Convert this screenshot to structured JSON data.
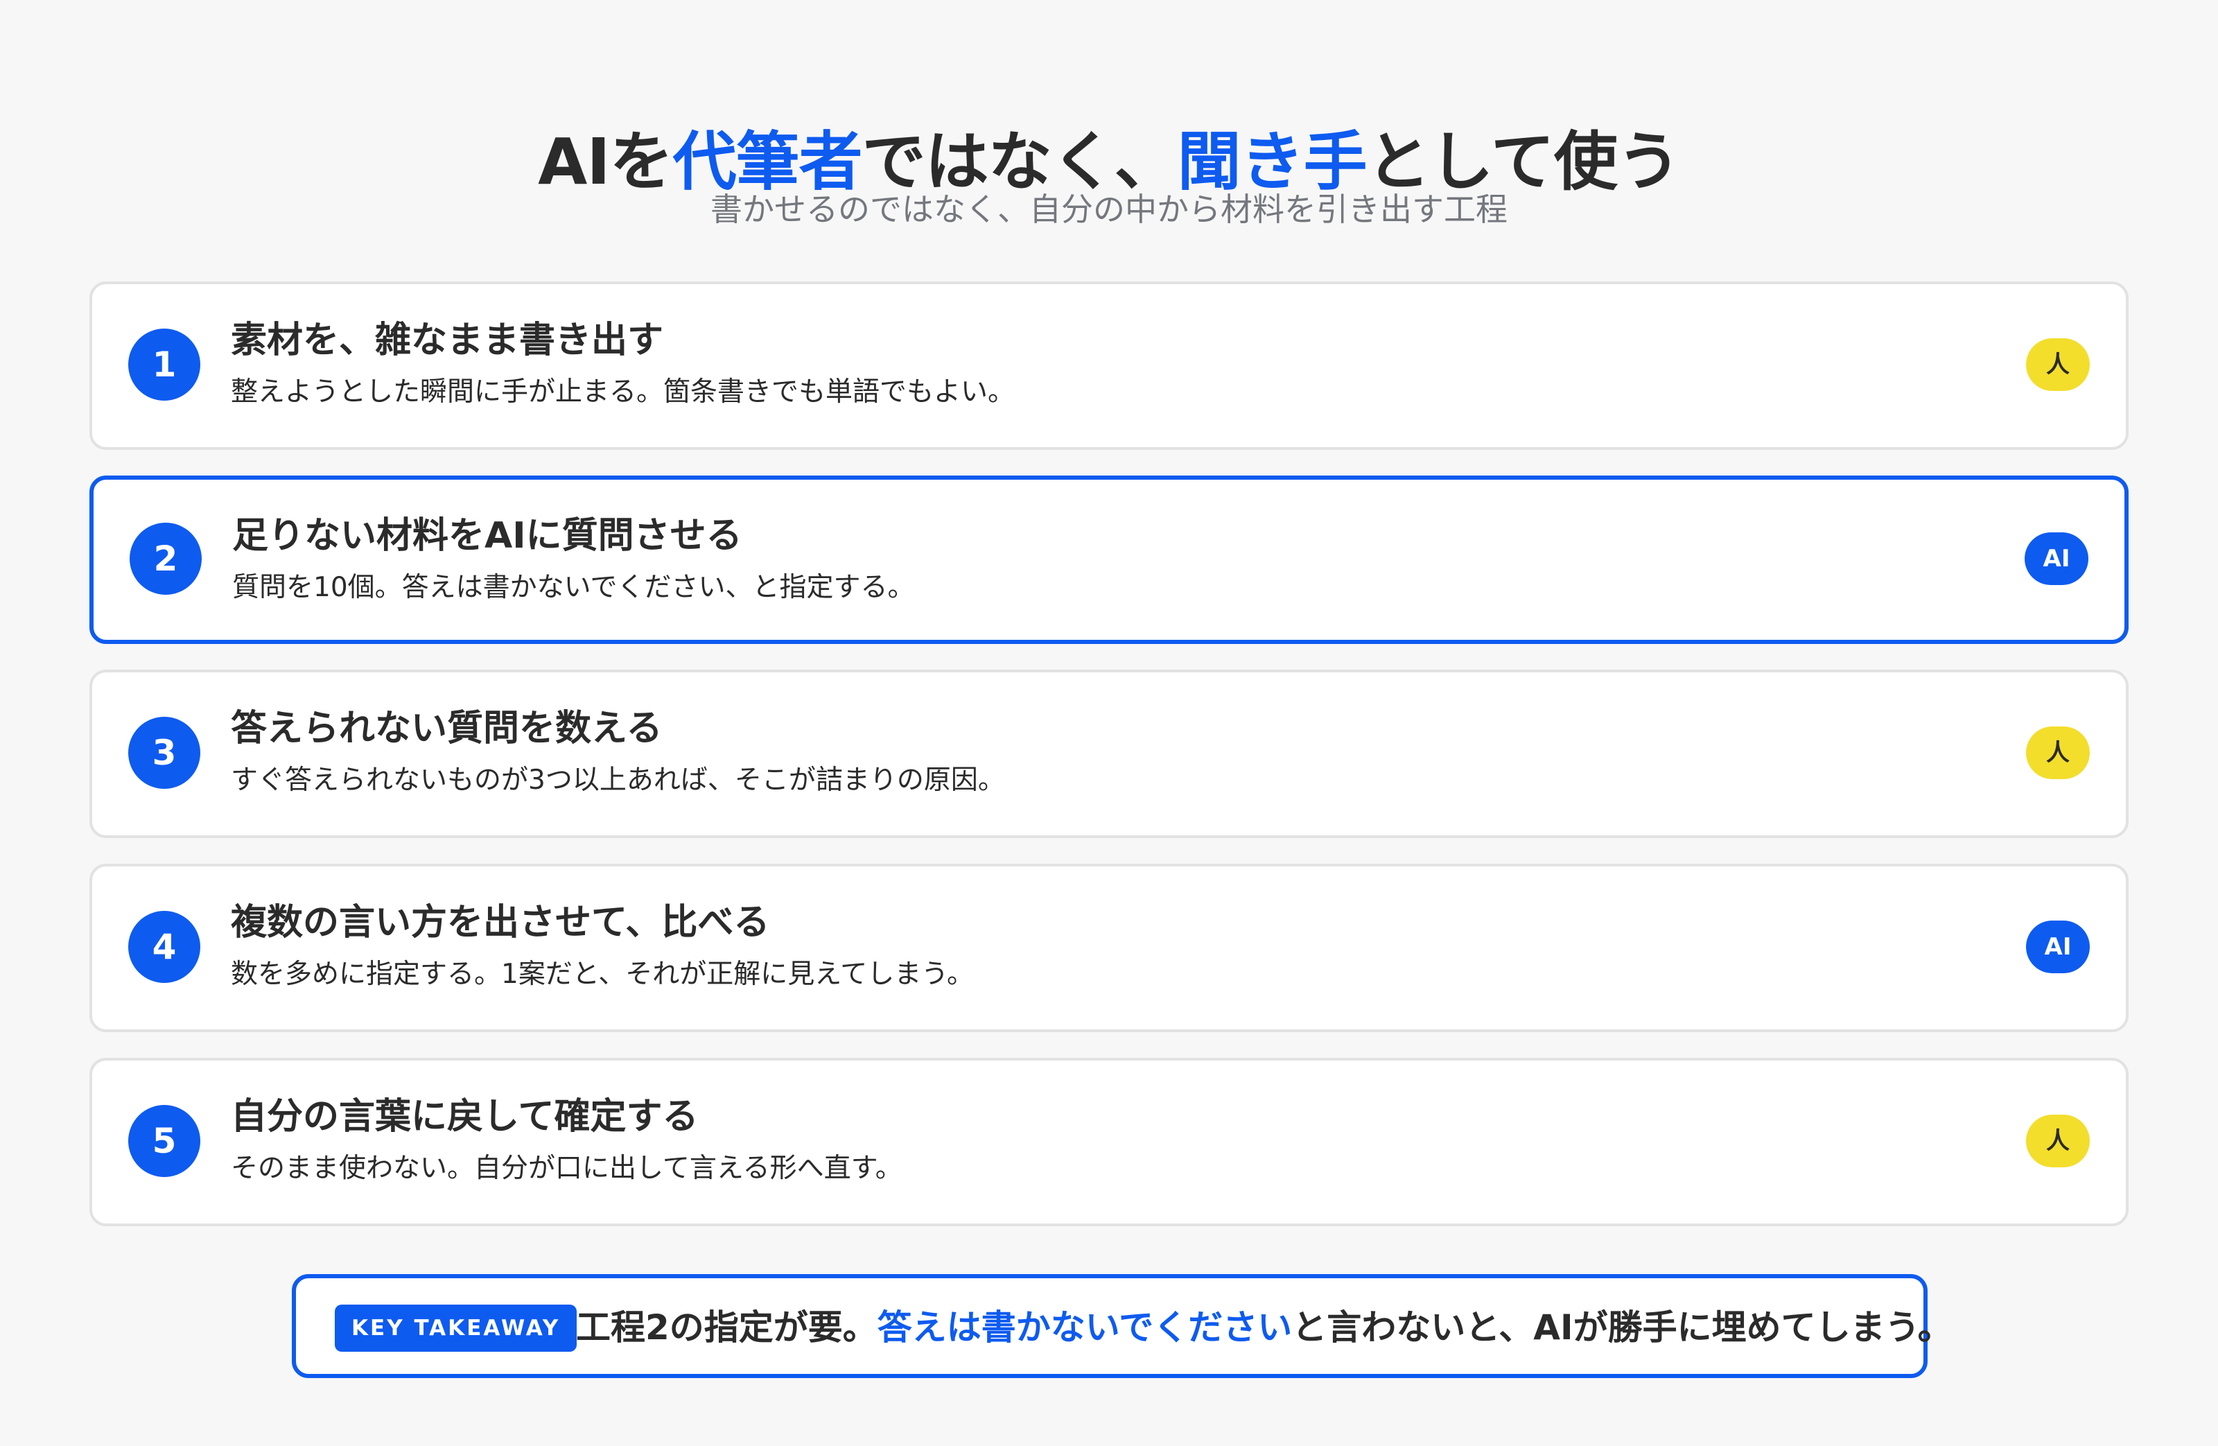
{
  "header": {
    "title_part1": "AIを",
    "title_accent1": "代筆者",
    "title_part2": "ではなく、",
    "title_accent2": "聞き手",
    "title_part3": "として使う",
    "subtitle": "書かせるのではなく、自分の中から材料を引き出す工程"
  },
  "steps": [
    {
      "number": "1",
      "title": "素材を、雑なまま書き出す",
      "description": "整えようとした瞬間に手が止まる。箇条書きでも単語でもよい。",
      "badge": "人"
    },
    {
      "number": "2",
      "title": "足りない材料をAIに質問させる",
      "description": "質問を10個。答えは書かないでください、と指定する。",
      "badge": "AI"
    },
    {
      "number": "3",
      "title": "答えられない質問を数える",
      "description": "すぐ答えられないものが3つ以上あれば、そこが詰まりの原因。",
      "badge": "人"
    },
    {
      "number": "4",
      "title": "複数の言い方を出させて、比べる",
      "description": "数を多めに指定する。1案だと、それが正解に見えてしまう。",
      "badge": "AI"
    },
    {
      "number": "5",
      "title": "自分の言葉に戻して確定する",
      "description": "そのまま使わない。自分が口に出して言える形へ直す。",
      "badge": "人"
    }
  ],
  "takeaway": {
    "tag": "KEY TAKEAWAY",
    "text_part1": "工程2の指定が要。",
    "text_accent": "答えは書かないでください",
    "text_part2": "と言わないと、AIが勝手に埋めてしまう。"
  },
  "colors": {
    "accent": "#0e5bf0",
    "human_badge": "#f3de2c",
    "background": "#f7f7f7",
    "card_border": "#e2e2e2"
  }
}
